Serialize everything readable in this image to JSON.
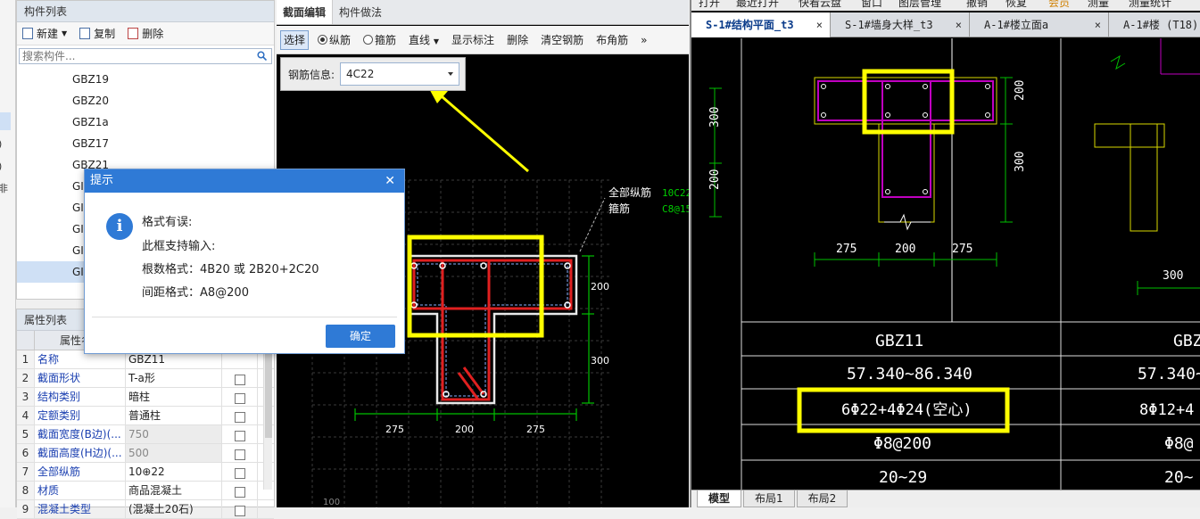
{
  "left_strip": {
    "marks": [
      ")",
      ")",
      "非"
    ]
  },
  "component_list": {
    "title": "构件列表",
    "toolbar": {
      "new": "新建",
      "copy": "复制",
      "delete": "删除"
    },
    "search_placeholder": "搜索构件...",
    "items": [
      "GBZ19",
      "GBZ20",
      "GBZ1a",
      "GBZ17",
      "GBZ21",
      "GI",
      "GI",
      "GI",
      "GI",
      "GI"
    ]
  },
  "properties": {
    "title": "属性列表",
    "header": {
      "name": "属性名称"
    },
    "rows": [
      {
        "num": "1",
        "name": "名称",
        "value": "GBZ11"
      },
      {
        "num": "2",
        "name": "截面形状",
        "value": "T-a形"
      },
      {
        "num": "3",
        "name": "结构类别",
        "value": "暗柱"
      },
      {
        "num": "4",
        "name": "定额类别",
        "value": "普通柱"
      },
      {
        "num": "5",
        "name": "截面宽度(B边)(...",
        "value": "750"
      },
      {
        "num": "6",
        "name": "截面高度(H边)(...",
        "value": "500"
      },
      {
        "num": "7",
        "name": "全部纵筋",
        "value": "10⊕22"
      },
      {
        "num": "8",
        "name": "材质",
        "value": "商品混凝土"
      },
      {
        "num": "9",
        "name": "混凝土类型",
        "value": "(混凝土20石)"
      }
    ]
  },
  "editor": {
    "tabs": [
      "截面编辑",
      "构件做法"
    ],
    "toolbar": {
      "select": "选择",
      "longitudinal": "纵筋",
      "stirrup": "箍筋",
      "line": "直线",
      "show_labels": "显示标注",
      "delete": "删除",
      "clear_rebar": "清空钢筋",
      "corner_rebar": "布角筋",
      "more": "»"
    },
    "rebar_info_label": "钢筋信息:",
    "rebar_info_value": "4C22",
    "drawing": {
      "label_all_long": "全部纵筋",
      "label_all_long_value": "10C22",
      "label_stirrup": "箍筋",
      "label_stirrup_value": "C8@15",
      "dim_200_right": "200",
      "dim_300_right": "300",
      "dim_275_left": "275",
      "dim_200_bottom": "200",
      "dim_275_right": "275",
      "grid_label": "100"
    }
  },
  "dialog": {
    "title": "提示",
    "lines": [
      "格式有误:",
      "此框支持输入:",
      "根数格式：4B20 或 2B20+2C20",
      "间距格式：A8@200"
    ],
    "ok": "确定"
  },
  "cad": {
    "menu": [
      "打开",
      "最近打开",
      "快看云盘",
      "窗口",
      "图层管理",
      "撤销",
      "恢复",
      "会员",
      "测量",
      "测量统计"
    ],
    "tabs": [
      "S-1#结构平面_t3",
      "S-1#墙身大样_t3",
      "A-1#楼立面a",
      "A-1#楼 (T18)"
    ],
    "dims": {
      "left_300": "300",
      "left_200": "200",
      "right_200": "200",
      "right_300": "300",
      "b1": "275",
      "b2": "200",
      "b3": "275",
      "far_300": "300"
    },
    "table": {
      "name": "GBZ11",
      "name2": "GBZ",
      "elevation": "57.340~86.340",
      "elevation2": "57.340~",
      "rebar": "6Φ22+4Φ24(空心)",
      "rebar2": "8Φ12+4",
      "stirrup": "Φ8@200",
      "stirrup2": "Φ8@",
      "range": "20~29",
      "range2": "20~"
    },
    "layout_tabs": [
      "模型",
      "布局1",
      "布局2"
    ]
  },
  "colors": {
    "highlight": "#ffff00",
    "rebar_red": "#e02020",
    "cad_magenta": "#c000c0",
    "cad_green": "#00c000",
    "dialog_blue": "#2f7ad6"
  }
}
